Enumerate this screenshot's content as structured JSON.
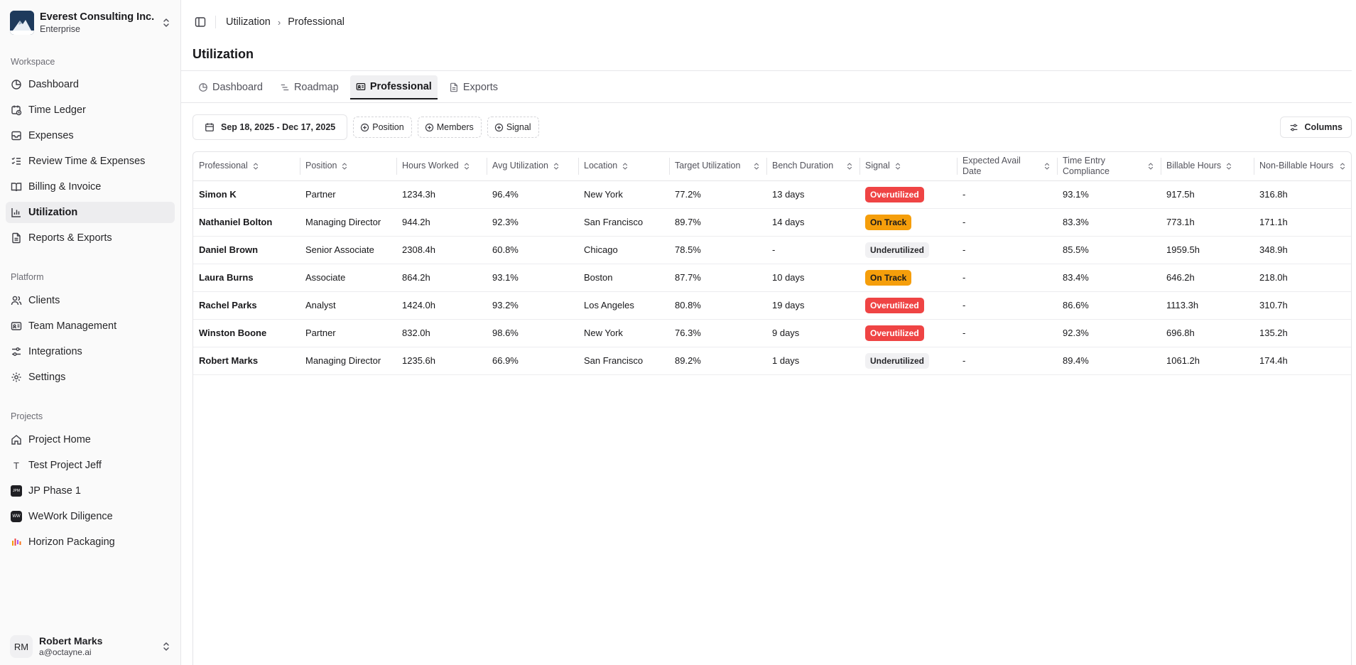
{
  "org": {
    "name": "Everest Consulting Inc.",
    "plan": "Enterprise"
  },
  "sidebar": {
    "workspace_label": "Workspace",
    "workspace": [
      {
        "label": "Dashboard",
        "icon": "pie-chart-icon"
      },
      {
        "label": "Time Ledger",
        "icon": "clock-calendar-icon"
      },
      {
        "label": "Expenses",
        "icon": "inbox-icon"
      },
      {
        "label": "Review Time & Expenses",
        "icon": "list-check-icon"
      },
      {
        "label": "Billing & Invoice",
        "icon": "book-open-icon"
      },
      {
        "label": "Utilization",
        "icon": "bar-chart-icon",
        "active": true
      },
      {
        "label": "Reports & Exports",
        "icon": "file-text-icon"
      }
    ],
    "platform_label": "Platform",
    "platform": [
      {
        "label": "Clients",
        "icon": "users-icon"
      },
      {
        "label": "Team Management",
        "icon": "id-card-icon"
      },
      {
        "label": "Integrations",
        "icon": "sliders-icon"
      },
      {
        "label": "Settings",
        "icon": "gear-icon"
      }
    ],
    "projects_label": "Projects",
    "projects": [
      {
        "label": "Project Home",
        "icon": "home-icon"
      },
      {
        "label": "Test Project Jeff",
        "badge": "T"
      },
      {
        "label": "JP Phase 1",
        "badge": "JPM"
      },
      {
        "label": "WeWork Diligence",
        "badge": "WW"
      },
      {
        "label": "Horizon Packaging",
        "icon": "horizon-logo-icon"
      }
    ]
  },
  "user": {
    "initials": "RM",
    "name": "Robert Marks",
    "email": "a@octayne.ai"
  },
  "breadcrumb": {
    "parent": "Utilization",
    "current": "Professional"
  },
  "page": {
    "title": "Utilization"
  },
  "tabs": [
    {
      "label": "Dashboard",
      "icon": "pie-chart-icon"
    },
    {
      "label": "Roadmap",
      "icon": "gantt-icon"
    },
    {
      "label": "Professional",
      "icon": "id-card-icon",
      "active": true
    },
    {
      "label": "Exports",
      "icon": "file-text-icon"
    }
  ],
  "filters": {
    "date_range": "Sep 18, 2025 - Dec 17, 2025",
    "chips": [
      "Position",
      "Members",
      "Signal"
    ],
    "columns_label": "Columns"
  },
  "table": {
    "columns": [
      "Professional",
      "Position",
      "Hours Worked",
      "Avg Utilization",
      "Location",
      "Target Utilization",
      "Bench Duration",
      "Signal",
      "Expected Avail Date",
      "Time Entry Compliance",
      "Billable Hours",
      "Non-Billable Hours"
    ],
    "rows": [
      [
        "Simon K",
        "Partner",
        "1234.3h",
        "96.4%",
        "New York",
        "77.2%",
        "13 days",
        "Overutilized",
        "-",
        "93.1%",
        "917.5h",
        "316.8h"
      ],
      [
        "Nathaniel Bolton",
        "Managing Director",
        "944.2h",
        "92.3%",
        "San Francisco",
        "89.7%",
        "14 days",
        "On Track",
        "-",
        "83.3%",
        "773.1h",
        "171.1h"
      ],
      [
        "Daniel Brown",
        "Senior Associate",
        "2308.4h",
        "60.8%",
        "Chicago",
        "78.5%",
        "-",
        "Underutilized",
        "-",
        "85.5%",
        "1959.5h",
        "348.9h"
      ],
      [
        "Laura Burns",
        "Associate",
        "864.2h",
        "93.1%",
        "Boston",
        "87.7%",
        "10 days",
        "On Track",
        "-",
        "83.4%",
        "646.2h",
        "218.0h"
      ],
      [
        "Rachel Parks",
        "Analyst",
        "1424.0h",
        "93.2%",
        "Los Angeles",
        "80.8%",
        "19 days",
        "Overutilized",
        "-",
        "86.6%",
        "1113.3h",
        "310.7h"
      ],
      [
        "Winston Boone",
        "Partner",
        "832.0h",
        "98.6%",
        "New York",
        "76.3%",
        "9 days",
        "Overutilized",
        "-",
        "92.3%",
        "696.8h",
        "135.2h"
      ],
      [
        "Robert Marks",
        "Managing Director",
        "1235.6h",
        "66.9%",
        "San Francisco",
        "89.2%",
        "1 days",
        "Underutilized",
        "-",
        "89.4%",
        "1061.2h",
        "174.4h"
      ]
    ]
  },
  "signal_colors": {
    "Overutilized": "#ef4444",
    "On Track": "#f59e0b",
    "Underutilized": "#f1f1f3"
  }
}
